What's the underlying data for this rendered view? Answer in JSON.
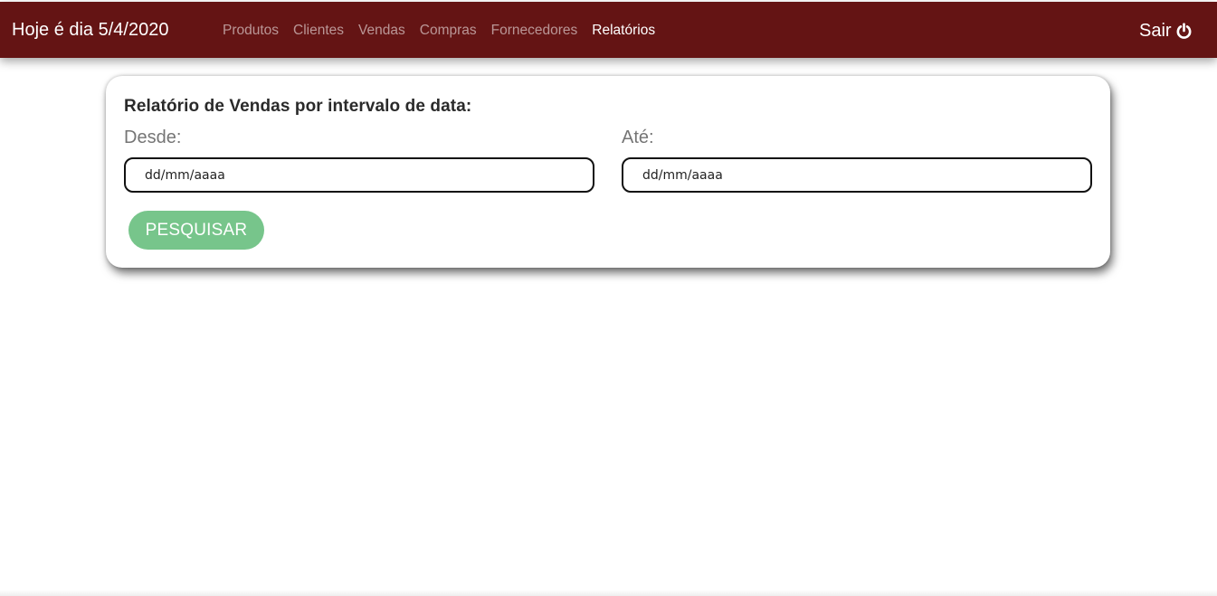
{
  "header": {
    "brand": "Hoje é dia 5/4/2020",
    "nav_links": [
      {
        "label": "Produtos",
        "active": false
      },
      {
        "label": "Clientes",
        "active": false
      },
      {
        "label": "Vendas",
        "active": false
      },
      {
        "label": "Compras",
        "active": false
      },
      {
        "label": "Fornecedores",
        "active": false
      },
      {
        "label": "Relatórios",
        "active": true
      }
    ],
    "logout_label": "Sair",
    "logout_icon": "power-icon"
  },
  "report_form": {
    "title": "Relatório de Vendas por intervalo de data:",
    "from_label": "Desde:",
    "from_placeholder": "dd/mm/aaaa",
    "to_label": "Até:",
    "to_placeholder": "dd/mm/aaaa",
    "search_button": "PESQUISAR"
  },
  "colors": {
    "navbar_bg": "#641414",
    "button_bg": "#77c58b",
    "label_text": "#757575"
  }
}
